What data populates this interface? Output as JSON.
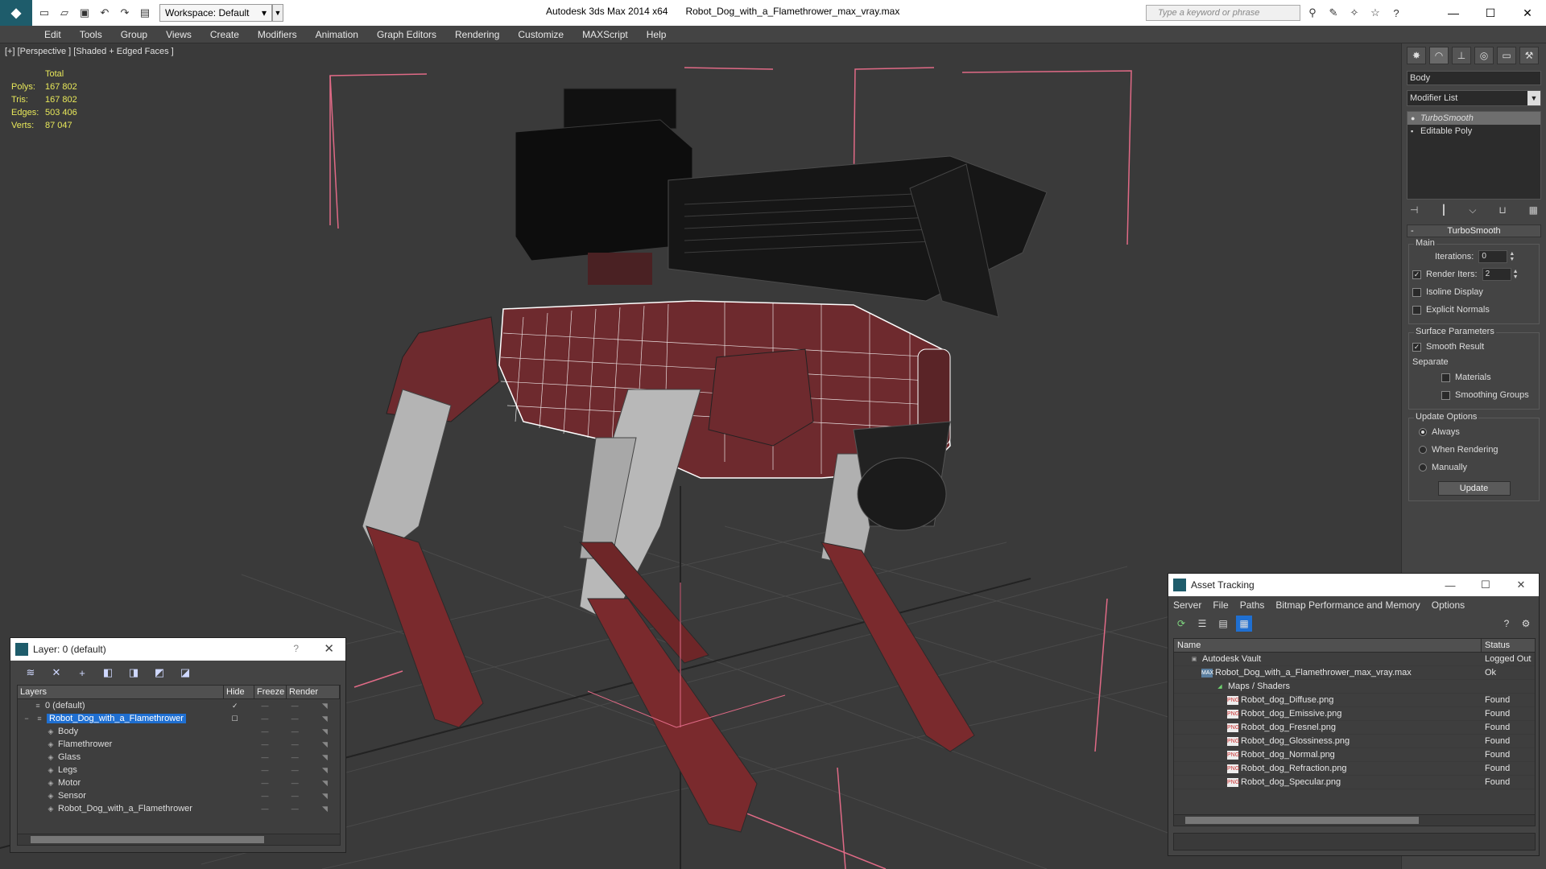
{
  "titlebar": {
    "workspace": "Workspace: Default",
    "app_name": "Autodesk 3ds Max  2014 x64",
    "file_name": "Robot_Dog_with_a_Flamethrower_max_vray.max",
    "search_placeholder": "Type a keyword or phrase"
  },
  "menu": [
    "Edit",
    "Tools",
    "Group",
    "Views",
    "Create",
    "Modifiers",
    "Animation",
    "Graph Editors",
    "Rendering",
    "Customize",
    "MAXScript",
    "Help"
  ],
  "viewport": {
    "label": "[+] [Perspective ] [Shaded + Edged Faces ]",
    "stats": {
      "header": "Total",
      "rows": [
        {
          "k": "Polys:",
          "v": "167 802"
        },
        {
          "k": "Tris:",
          "v": "167 802"
        },
        {
          "k": "Edges:",
          "v": "503 406"
        },
        {
          "k": "Verts:",
          "v": "87 047"
        }
      ]
    }
  },
  "command_panel": {
    "object_name": "Body",
    "modifier_list": "Modifier List",
    "stack": [
      "TurboSmooth",
      "Editable Poly"
    ],
    "rollout": "TurboSmooth",
    "main_group": "Main",
    "iterations_label": "Iterations:",
    "iterations_value": "0",
    "render_iters_label": "Render Iters:",
    "render_iters_value": "2",
    "isoline": "Isoline Display",
    "explicit_normals": "Explicit Normals",
    "surface_group": "Surface Parameters",
    "smooth_result": "Smooth Result",
    "separate": "Separate",
    "materials": "Materials",
    "smoothing_groups": "Smoothing Groups",
    "update_group": "Update Options",
    "always": "Always",
    "when_rendering": "When Rendering",
    "manually": "Manually",
    "update_button": "Update"
  },
  "layer_window": {
    "title": "Layer: 0 (default)",
    "help": "?",
    "columns": [
      "Layers",
      "Hide",
      "Freeze",
      "Render"
    ],
    "rows": [
      {
        "name": "0 (default)",
        "level": 0
      },
      {
        "name": "Robot_Dog_with_a_Flamethrower",
        "level": 0
      },
      {
        "name": "Body",
        "level": 1
      },
      {
        "name": "Flamethrower",
        "level": 1
      },
      {
        "name": "Glass",
        "level": 1
      },
      {
        "name": "Legs",
        "level": 1
      },
      {
        "name": "Motor",
        "level": 1
      },
      {
        "name": "Sensor",
        "level": 1
      },
      {
        "name": "Robot_Dog_with_a_Flamethrower",
        "level": 1
      }
    ]
  },
  "asset_window": {
    "title": "Asset Tracking",
    "menu": [
      "Server",
      "File",
      "Paths",
      "Bitmap Performance and Memory",
      "Options"
    ],
    "columns": [
      "Name",
      "Status"
    ],
    "rows": [
      {
        "name": "Autodesk Vault",
        "status": "Logged Out",
        "level": 0,
        "icon": "vault-icon"
      },
      {
        "name": "Robot_Dog_with_a_Flamethrower_max_vray.max",
        "status": "Ok",
        "level": 1,
        "icon": "max-file-icon"
      },
      {
        "name": "Maps / Shaders",
        "status": "",
        "level": 2,
        "icon": "maps-icon"
      },
      {
        "name": "Robot_dog_Diffuse.png",
        "status": "Found",
        "level": 3,
        "icon": "png-icon"
      },
      {
        "name": "Robot_dog_Emissive.png",
        "status": "Found",
        "level": 3,
        "icon": "png-icon"
      },
      {
        "name": "Robot_dog_Fresnel.png",
        "status": "Found",
        "level": 3,
        "icon": "png-icon"
      },
      {
        "name": "Robot_dog_Glossiness.png",
        "status": "Found",
        "level": 3,
        "icon": "png-icon"
      },
      {
        "name": "Robot_dog_Normal.png",
        "status": "Found",
        "level": 3,
        "icon": "png-icon"
      },
      {
        "name": "Robot_dog_Refraction.png",
        "status": "Found",
        "level": 3,
        "icon": "png-icon"
      },
      {
        "name": "Robot_dog_Specular.png",
        "status": "Found",
        "level": 3,
        "icon": "png-icon"
      }
    ]
  },
  "colors": {
    "selection": "#1f6fd1",
    "stats_text": "#e8e85a",
    "bounding_box": "#e06a86",
    "body_red": "#6e2a2e"
  }
}
